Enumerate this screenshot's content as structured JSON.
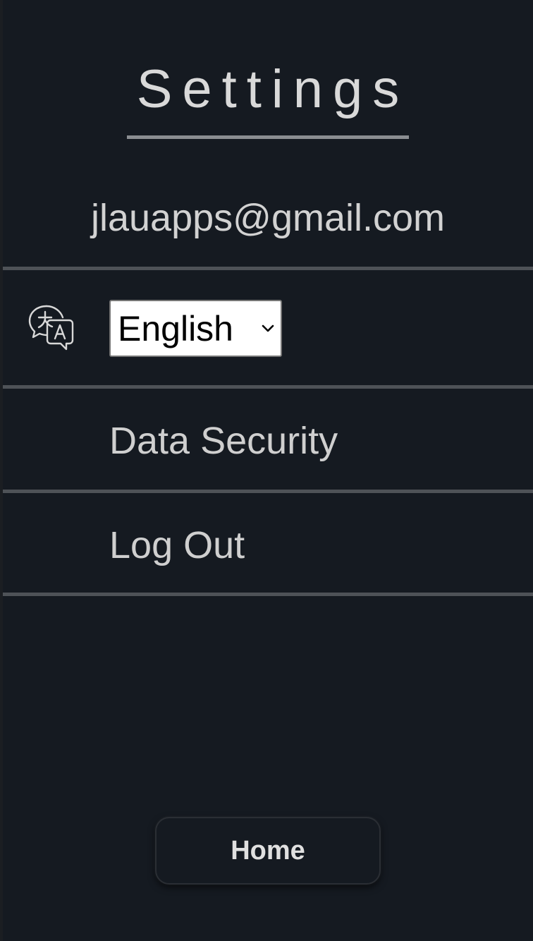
{
  "header": {
    "title": "Settings"
  },
  "account": {
    "email": "jlauapps@gmail.com"
  },
  "language": {
    "icon": "translate-icon",
    "selected": "English"
  },
  "menu": {
    "data_security": "Data Security",
    "log_out": "Log Out"
  },
  "footer": {
    "home_label": "Home"
  },
  "colors": {
    "background": "#151a21",
    "divider": "#4e5257",
    "text": "#cfcfcf"
  }
}
